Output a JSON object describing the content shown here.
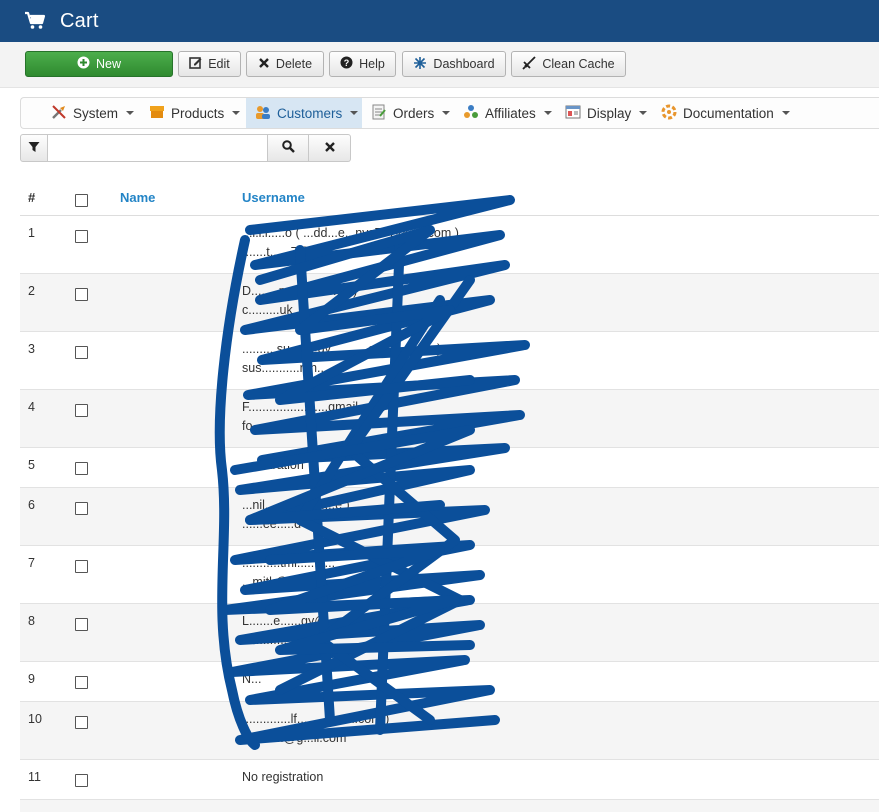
{
  "header": {
    "title": "Cart",
    "icon": "cart-icon"
  },
  "toolbar": {
    "new_label": "New",
    "edit_label": "Edit",
    "delete_label": "Delete",
    "help_label": "Help",
    "dashboard_label": "Dashboard",
    "clean_cache_label": "Clean Cache",
    "colors": {
      "new_button": "#3a9d3a"
    }
  },
  "menu": {
    "items": [
      {
        "label": "System",
        "icon": "tools-icon"
      },
      {
        "label": "Products",
        "icon": "box-icon"
      },
      {
        "label": "Customers",
        "icon": "users-icon",
        "active": true
      },
      {
        "label": "Orders",
        "icon": "orders-icon"
      },
      {
        "label": "Affiliates",
        "icon": "affiliates-icon"
      },
      {
        "label": "Display",
        "icon": "display-icon"
      },
      {
        "label": "Documentation",
        "icon": "documentation-icon"
      }
    ],
    "active_color": "#d7e6f3"
  },
  "filter": {
    "search_value": "",
    "placeholder": ""
  },
  "table": {
    "headers": {
      "number": "#",
      "name": "Name",
      "username": "Username"
    },
    "rows": [
      {
        "number": "1",
        "line1": "...l.l.i.....o ( ...dd...e...nys777@...il.com )",
        "line2": "t......t......7@g..."
      },
      {
        "number": "2",
        "line1": "D........ps..........c.uk )",
        "line2": "c.........uk"
      },
      {
        "number": "3",
        "line1": "..........su........gy...........gm.......com )",
        "line2": "sus...........nm..."
      },
      {
        "number": "4",
        "line1": "F.......................gmail.com )",
        "line2": "fo.........m........"
      },
      {
        "number": "5",
        "line1": "......stration",
        "line2": ""
      },
      {
        "number": "6",
        "line1": "...nil.......( ...........e )",
        "line2": "......ee.....d"
      },
      {
        "number": "7",
        "line1": "...........tmi...........",
        "line2": "...mjtk@..."
      },
      {
        "number": "8",
        "line1": "L.......e......gy@......com )",
        "line2": "...................uk"
      },
      {
        "number": "9",
        "line1": "N...",
        "line2": ""
      },
      {
        "number": "10",
        "line1": "..............lf..........mail.com )",
        "line2": "...f........@g...il.com"
      },
      {
        "number": "11",
        "line1": "No registration",
        "line2": ""
      }
    ],
    "colors": {
      "header_link": "#2384c6",
      "alt_row": "#f5f5f5"
    }
  },
  "redaction": {
    "color": "#0b4f9a"
  }
}
